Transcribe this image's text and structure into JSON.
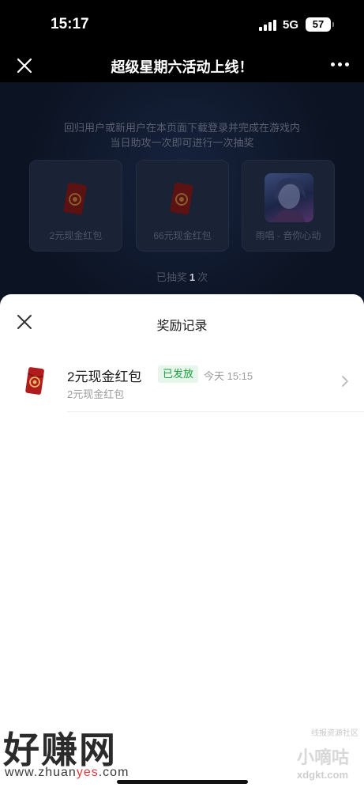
{
  "status_bar": {
    "time": "15:17",
    "network": "5G",
    "battery": "57"
  },
  "nav": {
    "title": "超级星期六活动上线！",
    "close_icon": "close-icon",
    "more_icon": "more-icon"
  },
  "background_page": {
    "notice_line1": "回归用户或新用户在本页面下载登录并完成在游戏内",
    "notice_line2": "当日助攻一次即可进行一次抽奖",
    "prizes": [
      {
        "label": "2元现金红包",
        "icon": "red-envelope-icon"
      },
      {
        "label": "66元现金红包",
        "icon": "red-envelope-icon"
      },
      {
        "label": "雨唱 - 音你心动",
        "icon": "character-avatar"
      }
    ],
    "draw_count_prefix": "已抽奖",
    "draw_count_value": "1",
    "draw_count_suffix": "次"
  },
  "sheet": {
    "title": "奖励记录",
    "records": [
      {
        "name": "2元现金红包",
        "status": "已发放",
        "time": "今天 15:15",
        "sub": "2元现金红包",
        "icon": "red-envelope-icon"
      }
    ]
  },
  "watermarks": {
    "left_big": "好赚网",
    "left_url_pre": "www.zhuan",
    "left_url_mid": "yes",
    "left_url_post": ".com",
    "right_top": "线报资源社区",
    "right_mid": "小嘀咕",
    "right_bot": "xdgkt.com"
  },
  "colors": {
    "status_badge_bg": "#e7f6ea",
    "status_badge_text": "#1f9d3f",
    "envelope_red": "#b01c1c",
    "background_dark": "#0e1526"
  }
}
